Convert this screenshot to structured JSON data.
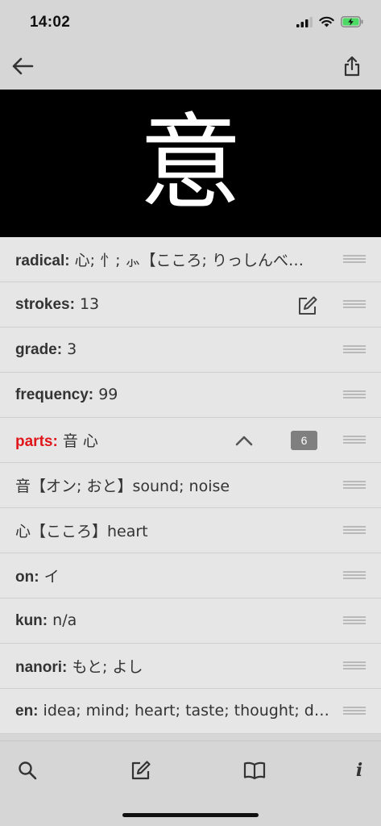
{
  "status_bar": {
    "time": "14:02",
    "icons": [
      "cellular-signal-icon",
      "wifi-icon",
      "battery-charging-icon"
    ]
  },
  "nav": {
    "back_icon": "arrow-left-icon",
    "share_icon": "share-icon"
  },
  "kanji": "意",
  "rows": [
    {
      "label": "radical:",
      "value": "心; 忄; ⺗【こころ; りっしんべ…"
    },
    {
      "label": "strokes:",
      "value": "13"
    },
    {
      "label": "grade:",
      "value": "3"
    },
    {
      "label": "frequency:",
      "value": "99"
    },
    {
      "label": "parts:",
      "value": "音 心",
      "badge": "6"
    },
    {
      "text": "音【オン; おと】sound; noise"
    },
    {
      "text": "心【こころ】heart"
    },
    {
      "label": "on:",
      "value": "イ"
    },
    {
      "label": "kun:",
      "value": "n/a"
    },
    {
      "label": "nanori:",
      "value": "もと; よし"
    },
    {
      "label": "en:",
      "value": "idea; mind; heart; taste; thought; desire…"
    }
  ],
  "tab_bar": {
    "items": [
      "search-icon",
      "edit-icon",
      "book-icon",
      "info-icon"
    ],
    "info_label": "i"
  },
  "colors": {
    "accent_red": "#e0161b",
    "banner_bg": "#000000",
    "badge_bg": "#7f7f7f"
  }
}
